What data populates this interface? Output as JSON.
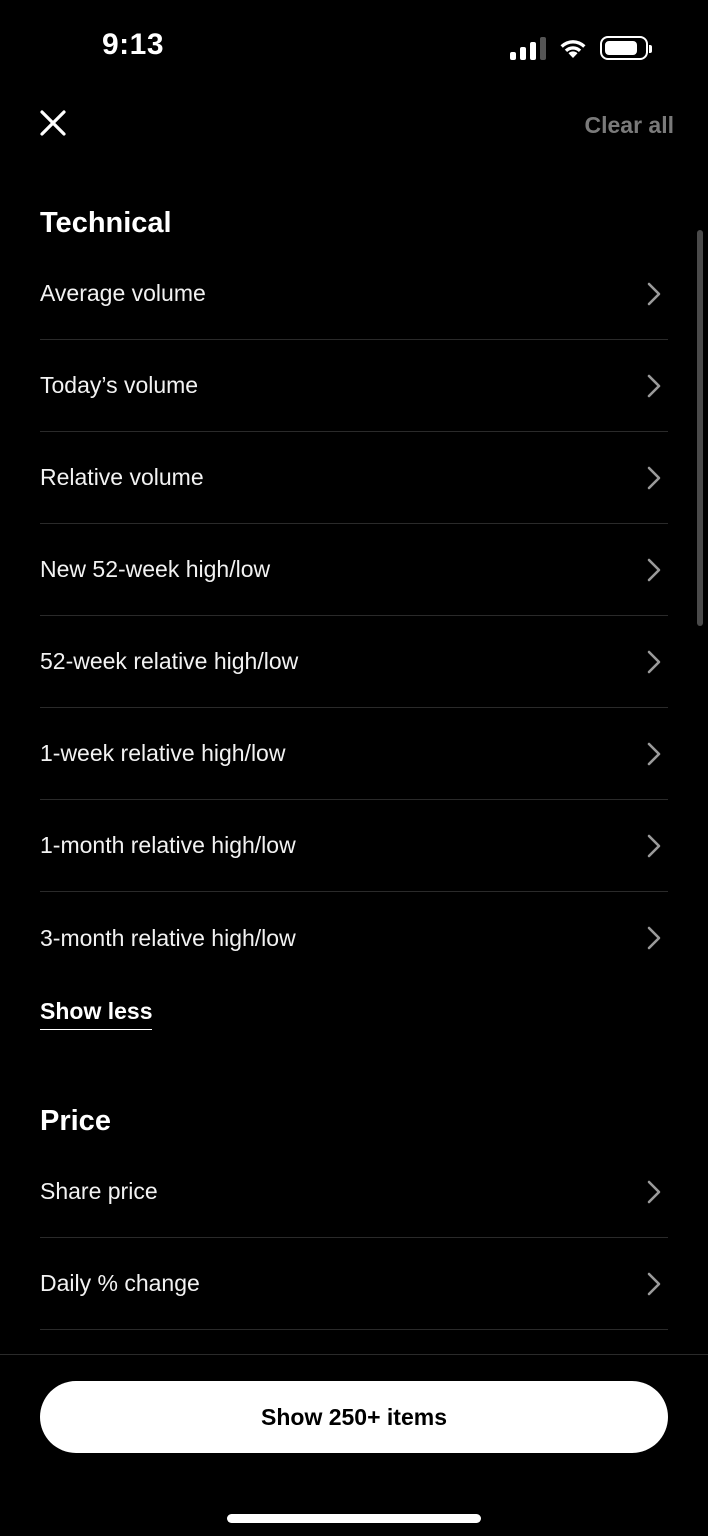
{
  "status_bar": {
    "time": "9:13",
    "icons": [
      "cellular-signal-icon",
      "wifi-icon",
      "battery-icon"
    ]
  },
  "header": {
    "close_icon": "close-icon",
    "clear_all_label": "Clear all"
  },
  "technical": {
    "title": "Technical",
    "items": [
      {
        "label": "Average volume"
      },
      {
        "label": "Today’s volume"
      },
      {
        "label": "Relative volume"
      },
      {
        "label": "New 52-week high/low"
      },
      {
        "label": "52-week relative high/low"
      },
      {
        "label": "1-week relative high/low"
      },
      {
        "label": "1-month relative high/low"
      },
      {
        "label": "3-month relative high/low"
      }
    ],
    "show_less_label": "Show less"
  },
  "price": {
    "title": "Price",
    "items": [
      {
        "label": "Share price"
      },
      {
        "label": "Daily % change"
      }
    ]
  },
  "footer": {
    "cta_label": "Show 250+ items"
  },
  "colors": {
    "background": "#000000",
    "text": "#ffffff",
    "muted": "#7a7a7a",
    "divider": "#2a2a2a",
    "button_bg": "#ffffff",
    "button_text": "#000000"
  }
}
